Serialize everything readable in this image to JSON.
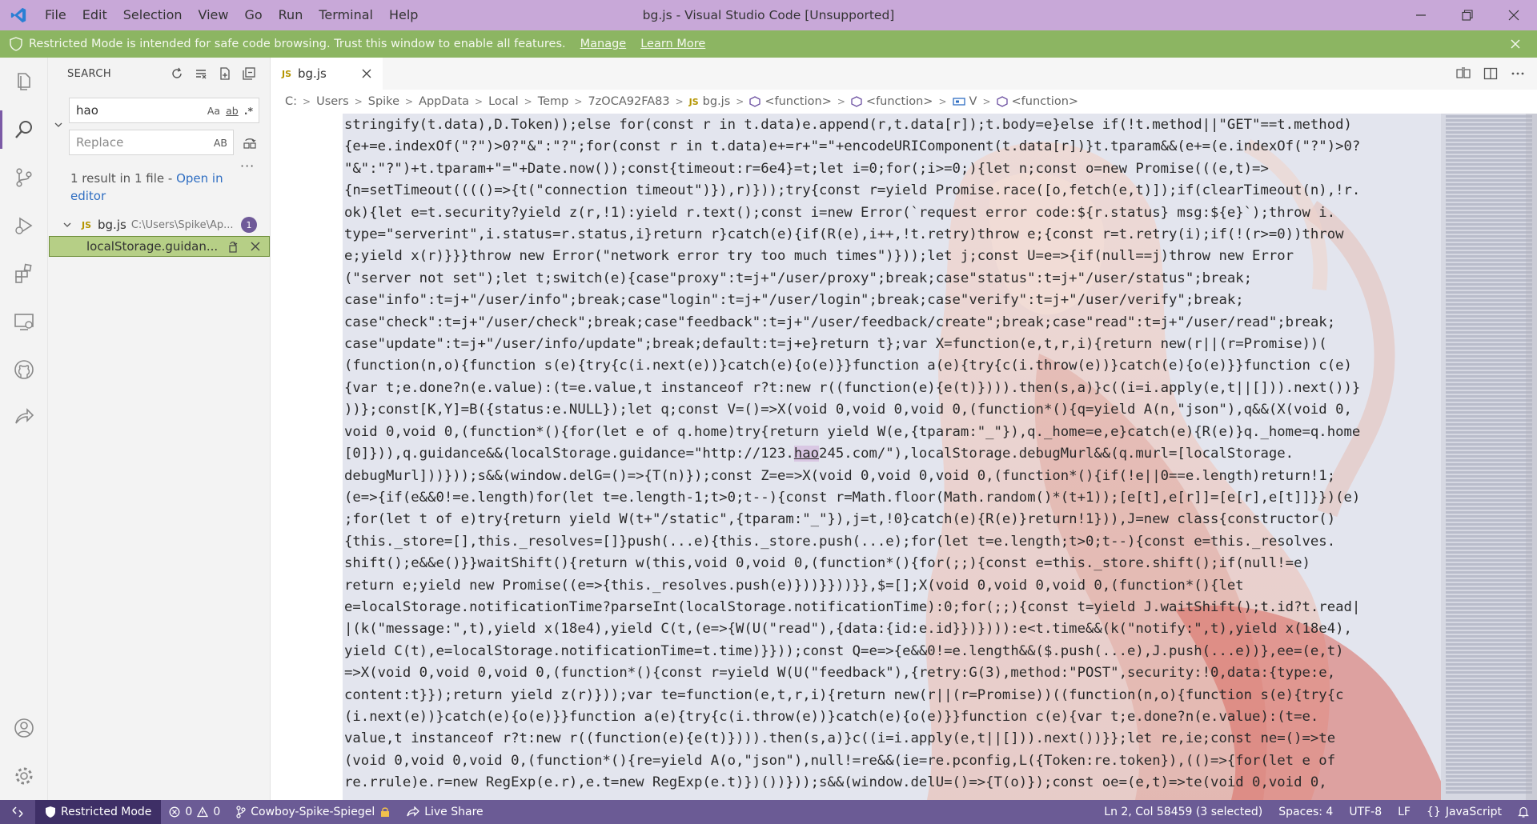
{
  "titlebar": {
    "menu": [
      "File",
      "Edit",
      "Selection",
      "View",
      "Go",
      "Run",
      "Terminal",
      "Help"
    ],
    "title": "bg.js - Visual Studio Code [Unsupported]"
  },
  "banner": {
    "message": "Restricted Mode is intended for safe code browsing. Trust this window to enable all features.",
    "manage": "Manage",
    "learn_more": "Learn More"
  },
  "sidebar": {
    "title": "SEARCH",
    "search_value": "hao",
    "search_options": [
      "Aa",
      "ab",
      ".*"
    ],
    "replace_placeholder": "Replace",
    "replace_option": "AB",
    "result_summary": "1 result in 1 file - ",
    "open_in_editor": "Open in editor",
    "file": {
      "name": "bg.js",
      "path": "C:\\Users\\Spike\\Ap...",
      "count": "1"
    },
    "match_text": "localStorage.guidan..."
  },
  "editor": {
    "tab_label": "bg.js",
    "breadcrumb": [
      "C:",
      "Users",
      "Spike",
      "AppData",
      "Local",
      "Temp",
      "7zOCA92FA83",
      "bg.js",
      "<function>",
      "<function>",
      "V",
      "<function>"
    ],
    "lines": [
      "stringify(t.data),D.Token));else for(const r in t.data)e.append(r,t.data[r]);t.body=e}else if(!t.method||\"GET\"==t.method)",
      "{e+=e.indexOf(\"?\")>0?\"&\":\"?\";for(const r in t.data)e+=r+\"=\"+encodeURIComponent(t.data[r])}t.tparam&&(e+=(e.indexOf(\"?\")>0?",
      "\"&\":\"?\")+t.tparam+\"=\"+Date.now());const{timeout:r=6e4}=t;let i=0;for(;i>=0;){let n;const o=new Promise(((e,t)=>",
      "{n=setTimeout(((()=>{t(\"connection timeout\")}),r)}));try{const r=yield Promise.race([o,fetch(e,t)]);if(clearTimeout(n),!r.",
      "ok){let e=t.security?yield z(r,!1):yield r.text();const i=new Error(`request error code:${r.status} msg:${e}`);throw i.",
      "type=\"serverint\",i.status=r.status,i}return r}catch(e){if(R(e),i++,!t.retry)throw e;{const r=t.retry(i);if(!(r>=0))throw",
      "e;yield x(r)}}}throw new Error(\"network error try too much times\")}));let j;const U=e=>{if(null==j)throw new Error",
      "(\"server not set\");let t;switch(e){case\"proxy\":t=j+\"/user/proxy\";break;case\"status\":t=j+\"/user/status\";break;",
      "case\"info\":t=j+\"/user/info\";break;case\"login\":t=j+\"/user/login\";break;case\"verify\":t=j+\"/user/verify\";break;",
      "case\"check\":t=j+\"/user/check\";break;case\"feedback\":t=j+\"/user/feedback/create\";break;case\"read\":t=j+\"/user/read\";break;",
      "case\"update\":t=j+\"/user/info/update\";break;default:t=j+e}return t};var X=function(e,t,r,i){return new(r||(r=Promise))(",
      "(function(n,o){function s(e){try{c(i.next(e))}catch(e){o(e)}}function a(e){try{c(i.throw(e))}catch(e){o(e)}}function c(e)",
      "{var t;e.done?n(e.value):(t=e.value,t instanceof r?t:new r((function(e){e(t)}))).then(s,a)}c((i=i.apply(e,t||[])).next())}",
      "))};const[K,Y]=B({status:e.NULL});let q;const V=()=>X(void 0,void 0,void 0,(function*(){q=yield A(n,\"json\"),q&&(X(void 0,",
      "void 0,void 0,(function*(){for(let e of q.home)try{return yield W(e,{tparam:\"_\"}),q._home=e,e}catch(e){R(e)}q._home=q.home",
      "[0]})),q.guidance&&(localStorage.guidance=\"http://123.",
      "debugMurl]))}));s&&(window.delG=()=>{T(n)});const Z=e=>X(void 0,void 0,void 0,(function*(){if(!e||0==e.length)return!1;",
      "(e=>{if(e&&0!=e.length)for(let t=e.length-1;t>0;t--){const r=Math.floor(Math.random()*(t+1));[e[t],e[r]]=[e[r],e[t]]}})(e)",
      ";for(let t of e)try{return yield W(t+\"/static\",{tparam:\"_\"}),j=t,!0}catch(e){R(e)}return!1})),J=new class{constructor()",
      "{this._store=[],this._resolves=[]}push(...e){this._store.push(...e);for(let t=e.length;t>0;t--){const e=this._resolves.",
      "shift();e&&e()}}waitShift(){return w(this,void 0,void 0,(function*(){for(;;){const e=this._store.shift();if(null!=e)",
      "return e;yield new Promise((e=>{this._resolves.push(e)}))}}))}},$=[];X(void 0,void 0,void 0,(function*(){let",
      "e=localStorage.notificationTime?parseInt(localStorage.notificationTime):0;for(;;){const t=yield J.waitShift();t.id?t.read|",
      "|(k(\"message:\",t),yield x(18e4),yield C(t,(e=>{W(U(\"read\"),{data:{id:e.id}})}))):e<t.time&&(k(\"notify:\",t),yield x(18e4),",
      "yield C(t),e=localStorage.notificationTime=t.time)}}));const Q=e=>{e&&0!=e.length&&($.push(...e),J.push(...e))},ee=(e,t)",
      "=>X(void 0,void 0,void 0,(function*(){const r=yield W(U(\"feedback\"),{retry:G(3),method:\"POST\",security:!0,data:{type:e,",
      "content:t}});return yield z(r)}));var te=function(e,t,r,i){return new(r||(r=Promise))((function(n,o){function s(e){try{c",
      "(i.next(e))}catch(e){o(e)}}function a(e){try{c(i.throw(e))}catch(e){o(e)}}function c(e){var t;e.done?n(e.value):(t=e.",
      "value,t instanceof r?t:new r((function(e){e(t)}))).then(s,a)}c((i=i.apply(e,t||[])).next())}};let re,ie;const ne=()=>te",
      "(void 0,void 0,void 0,(function*(){re=yield A(o,\"json\"),null!=re&&(ie=re.pconfig,L({Token:re.token}),(()=>{for(let e of",
      "re.rrule)e.r=new RegExp(e.r),e.t=new RegExp(e.t)})())}));s&&(window.delU=()=>{T(o)});const oe=(e,t)=>te(void 0,void 0,"
    ],
    "highlight": {
      "match": "hao",
      "after": "245.com/\"),localStorage.debugMurl&&(q.murl=[localStorage."
    }
  },
  "statusbar": {
    "restricted": "Restricted Mode",
    "errors": "0",
    "warnings": "0",
    "branch": "Cowboy-Spike-Spiegel",
    "live_share": "Live Share",
    "position": "Ln 2, Col 58459 (3 selected)",
    "spaces": "Spaces: 4",
    "encoding": "UTF-8",
    "eol": "LF",
    "language": "JavaScript"
  }
}
